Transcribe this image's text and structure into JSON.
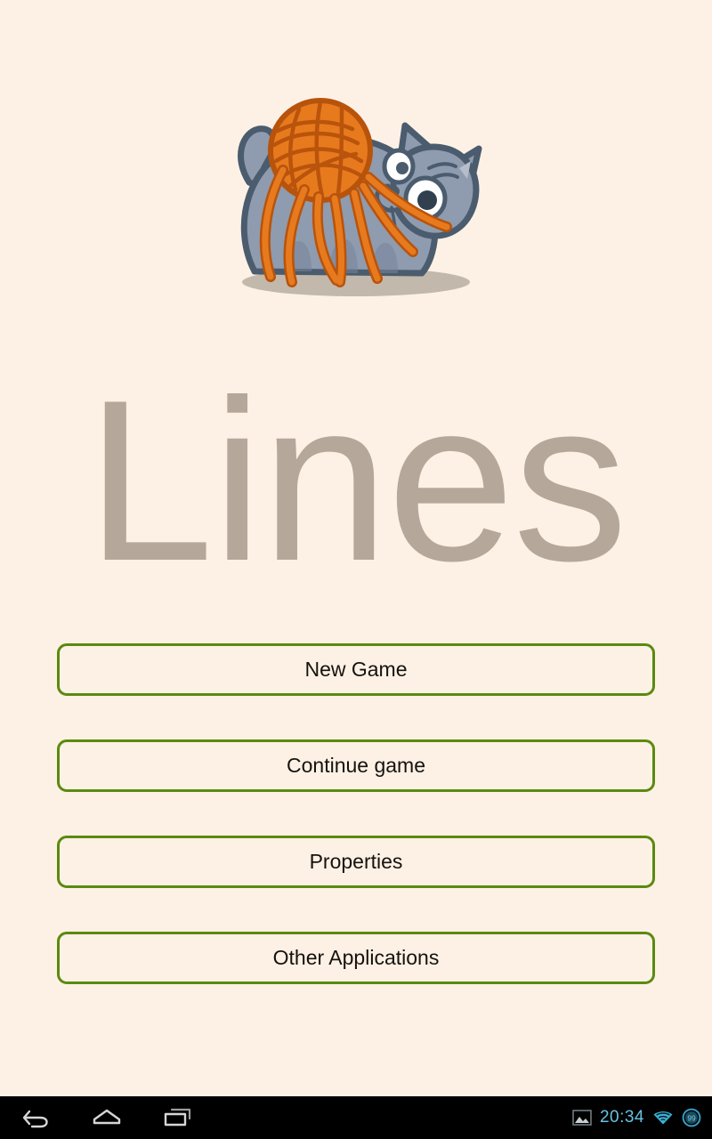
{
  "app": {
    "title": "Lines",
    "background_color": "#FDF1E5",
    "title_color": "#B5A79A",
    "accent_color": "#5B8A11"
  },
  "logo": {
    "name": "cat-with-yarn-ball-logo",
    "cat_body_color": "#8F9BAE",
    "cat_outline_color": "#4A5C6E",
    "yarn_color": "#E87A1E",
    "yarn_outline_color": "#B8530C",
    "shadow_color": "#B7AEA1"
  },
  "menu": {
    "buttons": [
      {
        "id": "new-game",
        "label": "New Game"
      },
      {
        "id": "continue-game",
        "label": "Continue game"
      },
      {
        "id": "properties",
        "label": "Properties"
      },
      {
        "id": "other-applications",
        "label": "Other Applications"
      }
    ]
  },
  "navbar": {
    "back_label": "Back",
    "home_label": "Home",
    "recents_label": "Recent apps",
    "status": {
      "screenshot_icon": "screenshot-icon",
      "clock": "20:34",
      "wifi_icon": "wifi-icon",
      "battery_level": "99",
      "icon_color": "#66c4e0"
    }
  }
}
